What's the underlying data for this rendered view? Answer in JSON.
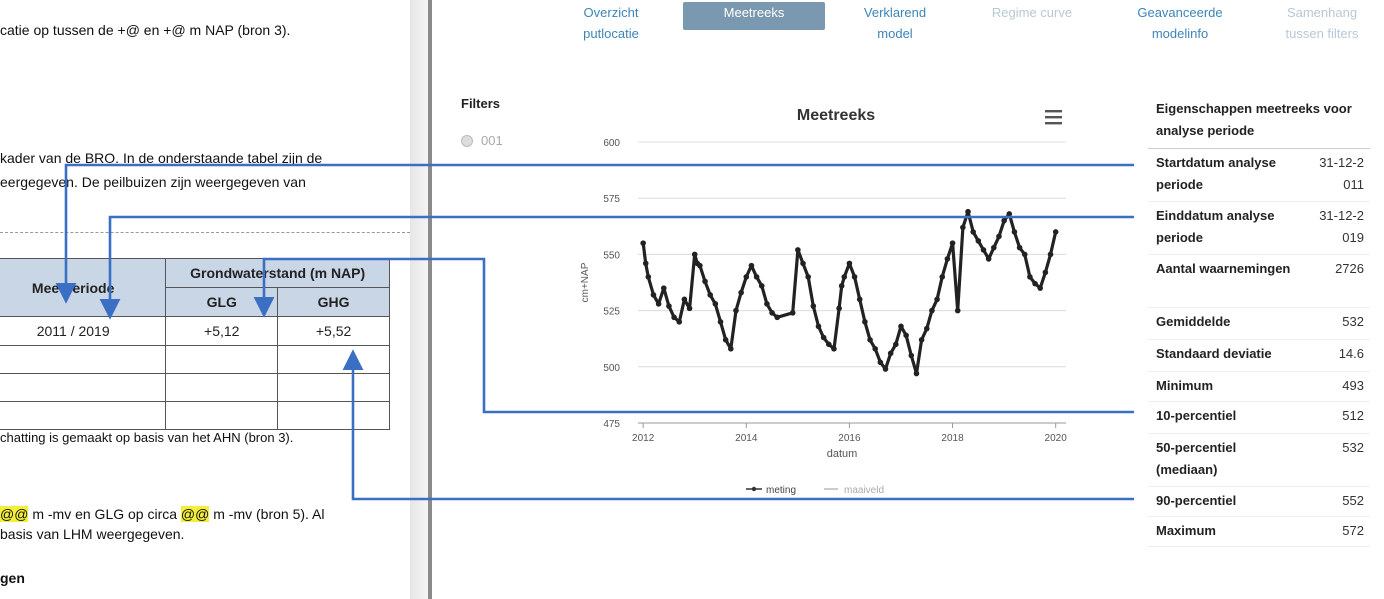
{
  "doc": {
    "line1": "catie op tussen de +@ en +@ m NAP (bron 3).",
    "line2": "kader van de BRO. In de onderstaande tabel zijn de",
    "line3": "eergegeven. De peilbuizen zijn weergegeven van",
    "table": {
      "col_meetperiode": "Meetperiode",
      "col_group": "Grondwaterstand (m NAP)",
      "col_glg": "GLG",
      "col_ghg": "GHG",
      "rows": [
        [
          "2011 / 2019",
          "+5,12",
          "+5,52"
        ]
      ]
    },
    "caption": "chatting is gemaakt op basis van het AHN (bron 3).",
    "line4_hl1": "@@",
    "line4_mid": " m -mv en GLG op circa ",
    "line4_hl2": "@@",
    "line4_end": " m -mv (bron 5). Al",
    "line5": "basis van LHM weergegeven.",
    "line6": "gen"
  },
  "tabs": [
    {
      "l1": "Overzicht",
      "l2": "putlocatie"
    },
    {
      "l1": "Meetreeks",
      "l2": ""
    },
    {
      "l1": "Verklarend",
      "l2": "model"
    },
    {
      "l1": "Regime curve",
      "l2": ""
    },
    {
      "l1": "Geavanceerde",
      "l2": "modelinfo"
    },
    {
      "l1": "Samenhang",
      "l2": "tussen filters"
    }
  ],
  "filters": {
    "title": "Filters",
    "item": "001"
  },
  "props": {
    "title": "Eigenschappen meetreeks voor analyse periode",
    "rows": [
      {
        "label": "Startdatum analyse periode",
        "value": "31-12-2011"
      },
      {
        "label": "Einddatum analyse periode",
        "value": "31-12-2019"
      },
      {
        "label": "Aantal waarnemingen",
        "value": "2726"
      },
      {
        "label": "Gemiddelde",
        "value": "532"
      },
      {
        "label": "Standaard deviatie",
        "value": "14.6"
      },
      {
        "label": "Minimum",
        "value": "493"
      },
      {
        "label": "10-percentiel",
        "value": "512"
      },
      {
        "label": "50-percentiel (mediaan)",
        "value": "532"
      },
      {
        "label": "90-percentiel",
        "value": "552"
      },
      {
        "label": "Maximum",
        "value": "572"
      }
    ]
  },
  "colors": {
    "accent": "#3a6fc4",
    "tab_active": "#7a99b1",
    "series": "#222222",
    "maaiveld": "#7fc9b6"
  },
  "chart_data": {
    "type": "line",
    "title": "Meetreeks",
    "xlabel": "datum",
    "ylabel": "cm+NAP",
    "xlim": [
      2011.9,
      2020.2
    ],
    "ylim": [
      475,
      600
    ],
    "xticks": [
      "2012",
      "2014",
      "2016",
      "2018",
      "2020"
    ],
    "yticks": [
      "475",
      "500",
      "525",
      "550",
      "575",
      "600"
    ],
    "grid": true,
    "legend": "bottom",
    "menu_icon": "hamburger-icon",
    "series": [
      {
        "name": "meting",
        "x": [
          2012.0,
          2012.05,
          2012.1,
          2012.2,
          2012.3,
          2012.4,
          2012.5,
          2012.6,
          2012.7,
          2012.8,
          2012.9,
          2013.0,
          2013.05,
          2013.1,
          2013.2,
          2013.3,
          2013.4,
          2013.5,
          2013.6,
          2013.7,
          2013.8,
          2013.9,
          2014.0,
          2014.1,
          2014.2,
          2014.3,
          2014.4,
          2014.5,
          2014.6,
          2014.9,
          2015.0,
          2015.1,
          2015.2,
          2015.3,
          2015.4,
          2015.5,
          2015.6,
          2015.7,
          2015.8,
          2015.85,
          2015.9,
          2016.0,
          2016.1,
          2016.2,
          2016.3,
          2016.4,
          2016.5,
          2016.6,
          2016.7,
          2016.8,
          2016.9,
          2017.0,
          2017.1,
          2017.2,
          2017.3,
          2017.4,
          2017.5,
          2017.6,
          2017.7,
          2017.8,
          2017.9,
          2018.0,
          2018.1,
          2018.2,
          2018.3,
          2018.4,
          2018.5,
          2018.6,
          2018.7,
          2018.8,
          2018.9,
          2019.0,
          2019.1,
          2019.2,
          2019.3,
          2019.4,
          2019.5,
          2019.6,
          2019.7,
          2019.8,
          2019.9,
          2020.0
        ],
        "y": [
          555,
          546,
          540,
          532,
          528,
          535,
          527,
          522,
          520,
          530,
          526,
          550,
          546,
          545,
          538,
          532,
          528,
          520,
          512,
          508,
          525,
          533,
          540,
          545,
          540,
          536,
          528,
          524,
          522,
          524,
          552,
          546,
          540,
          527,
          518,
          513,
          510,
          508,
          526,
          536,
          540,
          546,
          540,
          530,
          520,
          512,
          508,
          502,
          499,
          506,
          510,
          518,
          514,
          505,
          497,
          512,
          517,
          525,
          530,
          540,
          548,
          555,
          525,
          562,
          569,
          560,
          556,
          552,
          548,
          553,
          558,
          565,
          568,
          560,
          553,
          550,
          540,
          537,
          535,
          542,
          550,
          560
        ]
      },
      {
        "name": "maaiveld",
        "x": [],
        "y": []
      }
    ]
  },
  "overlay_arrows": [
    {
      "from": "startdatum",
      "to": "meetperiode"
    },
    {
      "from": "einddatum",
      "to": "meetperiode"
    },
    {
      "from": "10-percentiel",
      "to": "glg"
    },
    {
      "from": "90-percentiel",
      "to": "ghg"
    }
  ]
}
